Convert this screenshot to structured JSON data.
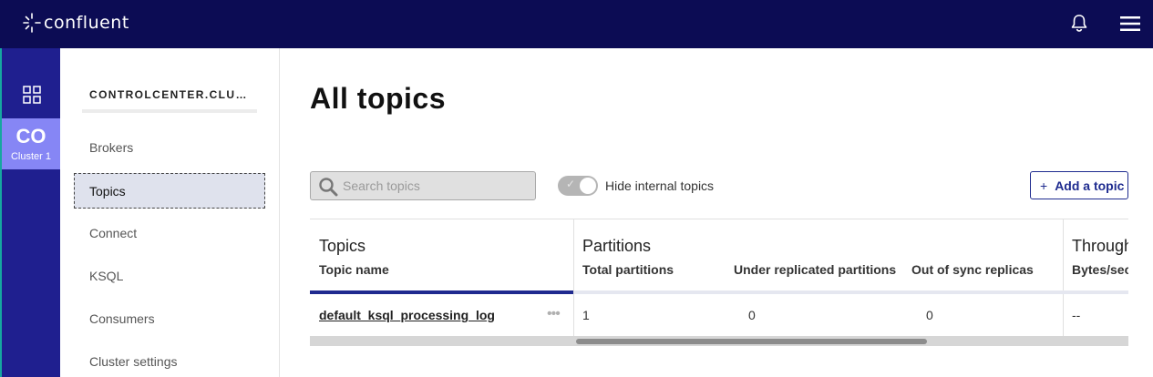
{
  "app": {
    "brand": "confluent"
  },
  "rail": {
    "cluster_abbr": "CO",
    "cluster_name": "Cluster 1"
  },
  "nav": {
    "cluster_title": "CONTROLCENTER.CLUSTER",
    "items": [
      {
        "label": "Brokers"
      },
      {
        "label": "Topics"
      },
      {
        "label": "Connect"
      },
      {
        "label": "KSQL"
      },
      {
        "label": "Consumers"
      },
      {
        "label": "Cluster settings"
      }
    ]
  },
  "main": {
    "title": "All topics",
    "search": {
      "placeholder": "Search topics",
      "value": ""
    },
    "toggle": {
      "label": "Hide internal topics",
      "on": true
    },
    "add_button": {
      "plus": "+",
      "label": "Add a topic"
    }
  },
  "table": {
    "groups": [
      {
        "title": "Topics"
      },
      {
        "title": "Partitions"
      },
      {
        "title": "Throughput"
      }
    ],
    "columns": [
      "Topic name",
      "Total partitions",
      "Under replicated partitions",
      "Out of sync replicas",
      "Bytes/sec"
    ],
    "rows": [
      {
        "topic": "default_ksql_processing_log",
        "total_partitions": "1",
        "under_replicated": "0",
        "out_of_sync": "0",
        "bytes_sec": "--"
      }
    ]
  },
  "icons": [
    "confluent-logo-icon",
    "bell-icon",
    "hamburger-menu-icon",
    "grid-icon",
    "search-icon",
    "check-icon",
    "more-horizontal-icon"
  ],
  "colors": {
    "topbar": "#0c0c54",
    "rail": "#1f1f8f",
    "cluster_tile": "#8686f5",
    "accent": "#1e2b8f",
    "nav_active": "#dfe2ed"
  }
}
